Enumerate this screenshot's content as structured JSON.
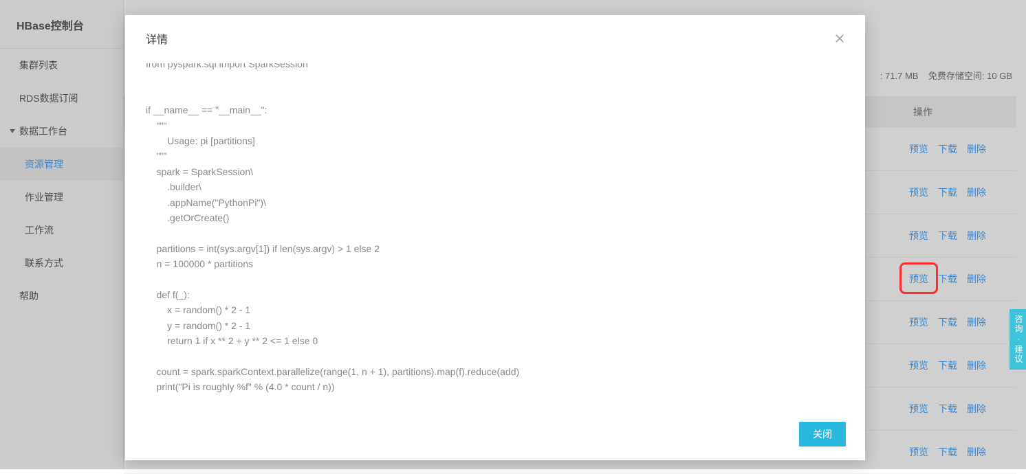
{
  "sidebar": {
    "title": "HBase控制台",
    "items": [
      {
        "label": "集群列表"
      },
      {
        "label": "RDS数据订阅"
      },
      {
        "label": "数据工作台",
        "expand": true
      },
      {
        "label": "资源管理",
        "sub": true,
        "active": true
      },
      {
        "label": "作业管理",
        "sub": true
      },
      {
        "label": "工作流",
        "sub": true
      },
      {
        "label": "联系方式",
        "sub": true
      },
      {
        "label": "帮助"
      }
    ]
  },
  "storage": {
    "used_label": ": 71.7 MB",
    "free_label": "免费存储空间: 10 GB"
  },
  "table": {
    "ops_header": "操作",
    "action_preview": "预览",
    "action_download": "下载",
    "action_delete": "删除",
    "row_count": 8,
    "highlight_row_index": 3
  },
  "modal": {
    "title": "详情",
    "close_btn": "关闭",
    "code": "from pyspark.sql import SparkSession\n\n\nif __name__ == \"__main__\":\n    \"\"\"\n        Usage: pi [partitions]\n    \"\"\"\n    spark = SparkSession\\\n        .builder\\\n        .appName(\"PythonPi\")\\\n        .getOrCreate()\n\n    partitions = int(sys.argv[1]) if len(sys.argv) > 1 else 2\n    n = 100000 * partitions\n\n    def f(_):\n        x = random() * 2 - 1\n        y = random() * 2 - 1\n        return 1 if x ** 2 + y ** 2 <= 1 else 0\n\n    count = spark.sparkContext.parallelize(range(1, n + 1), partitions).map(f).reduce(add)\n    print(\"Pi is roughly %f\" % (4.0 * count / n))\n\n    spark.stop()\n"
  },
  "feedback": {
    "label": "咨询·建议"
  }
}
